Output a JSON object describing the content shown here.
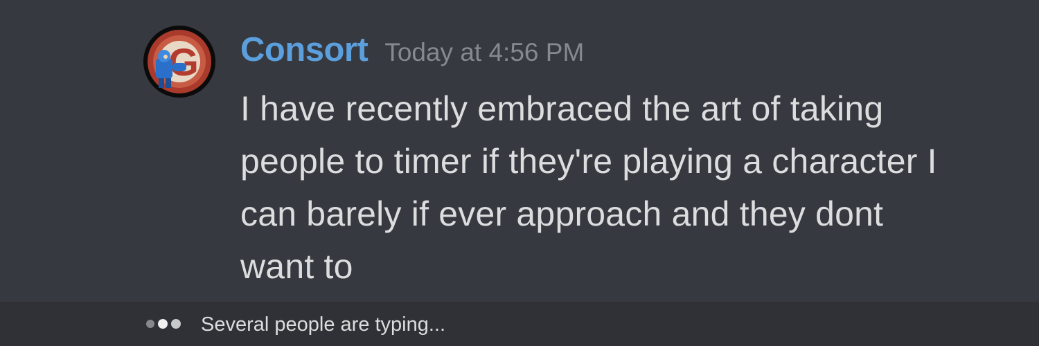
{
  "message": {
    "author": "Consort",
    "timestamp": "Today at 4:56 PM",
    "content": "I have recently embraced the art of taking people to timer if they're playing a character I can barely if ever approach and they dont want to",
    "avatar_icon": "user-avatar-icon",
    "avatar_letter": "G"
  },
  "typing_indicator": {
    "text": "Several people are typing..."
  },
  "colors": {
    "background": "#36393f",
    "typing_bar": "#2f3136",
    "username": "#5b9fdd",
    "timestamp": "#868990",
    "message_text": "#dcddde"
  }
}
